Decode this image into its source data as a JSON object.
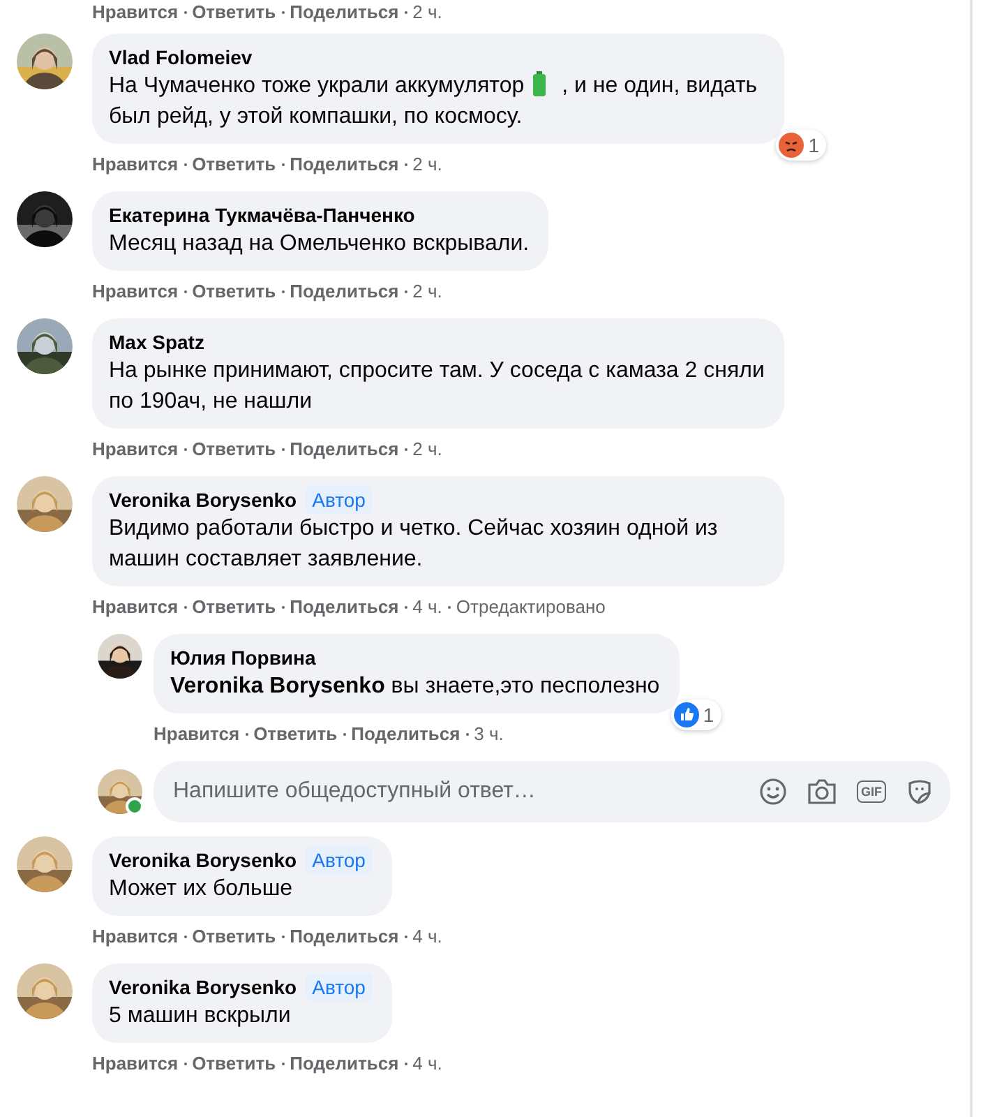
{
  "top_actions": {
    "like": "Нравится",
    "reply": "Ответить",
    "share": "Поделиться",
    "time": "2 ч."
  },
  "comments": [
    {
      "author": "Vlad Folomeiev",
      "text": "На Чумаченко тоже украли аккумулятор",
      "text_after": ", и не один, видать был рейд, у этой компашки, по космосу.",
      "reaction": {
        "kind": "angry",
        "count": "1"
      },
      "actions": {
        "like": "Нравится",
        "reply": "Ответить",
        "share": "Поделиться",
        "time": "2 ч."
      }
    },
    {
      "author": "Екатерина Тукмачёва-Панченко",
      "text": "Месяц назад на Омельченко вскрывали.",
      "actions": {
        "like": "Нравится",
        "reply": "Ответить",
        "share": "Поделиться",
        "time": "2 ч."
      }
    },
    {
      "author": "Max Spatz",
      "text": "На рынке принимают, спросите там. У соседа с камаза 2 сняли по 190ач, не нашли",
      "actions": {
        "like": "Нравится",
        "reply": "Ответить",
        "share": "Поделиться",
        "time": "2 ч."
      }
    },
    {
      "author": "Veronika Borysenko",
      "badge_label": "Автор",
      "text": "Видимо работали быстро и четко. Сейчас хозяин одной из машин составляет заявление.",
      "actions": {
        "like": "Нравится",
        "reply": "Ответить",
        "share": "Поделиться",
        "time": "4 ч.",
        "edited": "Отредактировано"
      },
      "replies": [
        {
          "author": "Юлия Порвина",
          "text": "**Veronika Borysenko** вы знаете,это песполезно",
          "reaction": {
            "kind": "like",
            "count": "1"
          },
          "actions": {
            "like": "Нравится",
            "reply": "Ответить",
            "share": "Поделиться",
            "time": "3 ч."
          }
        }
      ],
      "reply_box": {
        "placeholder": "Напишите общедоступный ответ…",
        "online": true,
        "gif_label": "GIF"
      }
    },
    {
      "author": "Veronika Borysenko",
      "badge_label": "Автор",
      "text": "Может их больше",
      "actions": {
        "like": "Нравится",
        "reply": "Ответить",
        "share": "Поделиться",
        "time": "4 ч."
      }
    },
    {
      "author": "Veronika Borysenko",
      "badge_label": "Автор",
      "text": "5 машин вскрыли",
      "actions": {
        "like": "Нравится",
        "reply": "Ответить",
        "share": "Поделиться",
        "time": "4 ч."
      }
    }
  ]
}
